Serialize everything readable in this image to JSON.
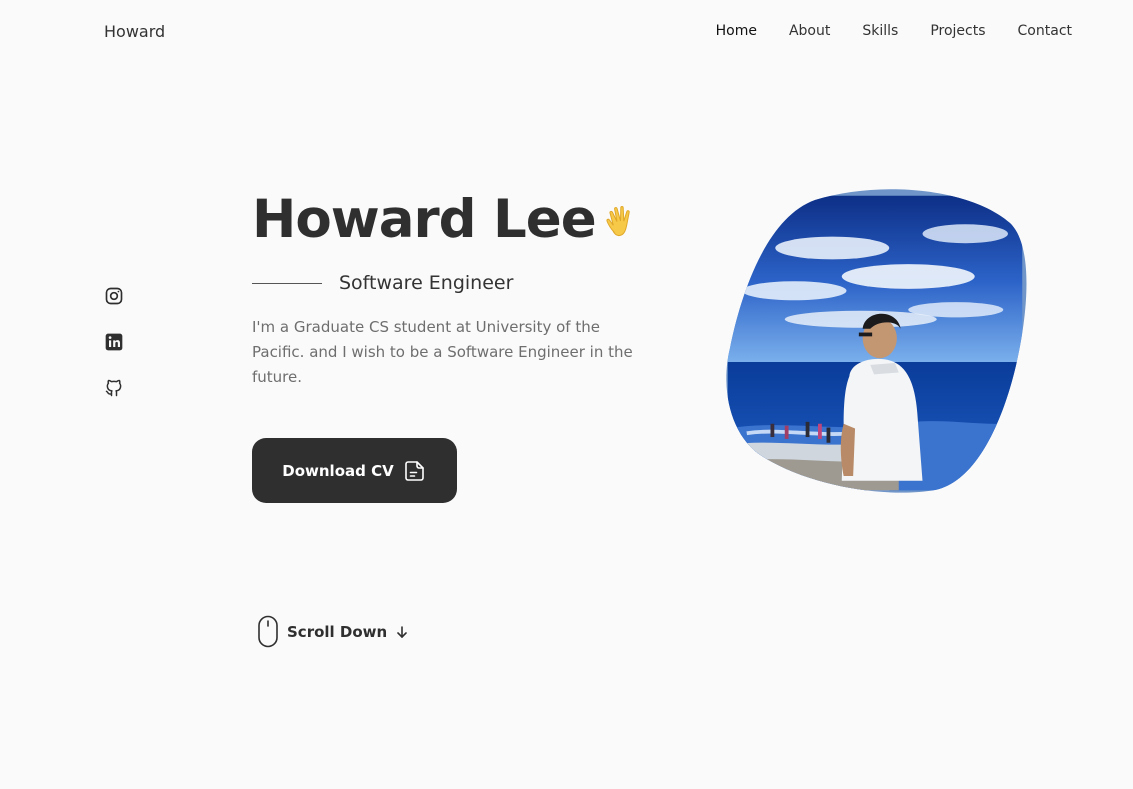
{
  "header": {
    "logo": "Howard",
    "nav": [
      {
        "label": "Home"
      },
      {
        "label": "About"
      },
      {
        "label": "Skills"
      },
      {
        "label": "Projects"
      },
      {
        "label": "Contact"
      }
    ]
  },
  "social": {
    "icons": [
      "instagram-icon",
      "linkedin-icon",
      "github-icon"
    ]
  },
  "hero": {
    "name": "Howard Lee",
    "role": "Software Engineer",
    "description": "I'm a Graduate CS student at University of the Pacific. and I wish to be a Software Engineer in the future.",
    "cv_button": "Download CV"
  },
  "scroll": {
    "label": "Scroll Down"
  },
  "colors": {
    "background": "#fafafa",
    "text": "#2f2f2f",
    "button": "#2f2f2f",
    "muted": "#6e6e6e"
  }
}
